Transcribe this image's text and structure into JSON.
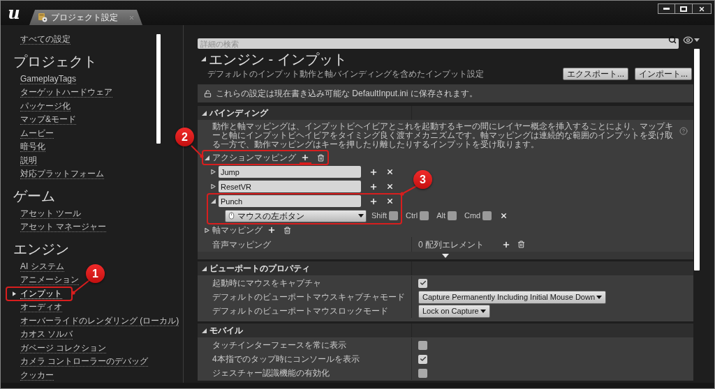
{
  "window": {
    "logo": "u",
    "tab": {
      "title": "プロジェクト設定",
      "selected": true
    }
  },
  "sidebar": {
    "items": [
      {
        "label": "すべての設定",
        "selected": false
      }
    ],
    "sections": [
      {
        "heading": "プロジェクト",
        "items": [
          {
            "label": "GameplayTags",
            "selected": false
          },
          {
            "label": "ターゲットハードウェア",
            "selected": false
          },
          {
            "label": "パッケージ化",
            "selected": false
          },
          {
            "label": "マップ&モード",
            "selected": false
          },
          {
            "label": "ムービー",
            "selected": false
          },
          {
            "label": "暗号化",
            "selected": false
          },
          {
            "label": "説明",
            "selected": false
          },
          {
            "label": "対応プラットフォーム",
            "selected": false
          }
        ]
      },
      {
        "heading": "ゲーム",
        "items": [
          {
            "label": "アセット ツール",
            "selected": false
          },
          {
            "label": "アセット マネージャー",
            "selected": false
          }
        ]
      },
      {
        "heading": "エンジン",
        "items": [
          {
            "label": "AI システム",
            "selected": false
          },
          {
            "label": "アニメーション",
            "selected": false
          },
          {
            "label": "インプット",
            "selected": true
          },
          {
            "label": "オーディオ",
            "selected": false
          },
          {
            "label": "オーバーライドのレンダリング (ローカル)",
            "selected": false
          },
          {
            "label": "カオス ソルバ",
            "selected": false
          },
          {
            "label": "ガベージ コレクション",
            "selected": false
          },
          {
            "label": "カメラ コントローラーのデバッグ",
            "selected": false
          },
          {
            "label": "クッカー",
            "selected": false
          }
        ]
      }
    ]
  },
  "search": {
    "placeholder": "詳細の検索"
  },
  "page": {
    "title": "エンジン - インプット",
    "expanded": true,
    "subtitle": "デフォルトのインプット動作と軸バインディングを含めたインプット設定",
    "buttons": [
      "エクスポート...",
      "インポート..."
    ]
  },
  "notice": "これらの設定は現在書き込み可能な DefaultInput.ini に保存されます。",
  "bindings": {
    "title": "バインディング",
    "expanded": true,
    "description": "動作と軸マッピングは、インプットビヘイビアとこれを起動するキーの間にレイヤー概念を挿入することにより、マップキーと軸にインプットビヘイビアをタイミング良く渡すメカニズムです。軸マッピングは連続的な範囲のインプットを受け取る一方で、動作マッピングはキーを押したり離したりするインプットを受け取ります。",
    "action_mappings": {
      "label": "アクションマッピング",
      "expanded": true,
      "items": [
        {
          "name": "Jump",
          "expanded": false
        },
        {
          "name": "ResetVR",
          "expanded": false
        },
        {
          "name": "Punch",
          "expanded": true,
          "keys": [
            {
              "key": "マウスの左ボタン",
              "modifiers": [
                {
                  "label": "Shift",
                  "checked": false
                },
                {
                  "label": "Ctrl",
                  "checked": false
                },
                {
                  "label": "Alt",
                  "checked": false
                },
                {
                  "label": "Cmd",
                  "checked": false
                }
              ]
            }
          ]
        }
      ]
    },
    "axis_mappings": {
      "label": "軸マッピング",
      "expanded": false
    },
    "speech_mappings": {
      "label": "音声マッピング",
      "value": "0 配列エレメント"
    }
  },
  "sections": [
    {
      "title": "ビューポートのプロパティ",
      "expanded": true,
      "rows": [
        {
          "kind": "checkbox",
          "label": "起動時にマウスをキャプチャ",
          "checked": true
        },
        {
          "kind": "dropdown",
          "label": "デフォルトのビューポートマウスキャプチャモード",
          "value": "Capture Permanently Including Initial Mouse Down"
        },
        {
          "kind": "dropdown",
          "label": "デフォルトのビューポートマウスロックモード",
          "value": "Lock on Capture"
        }
      ]
    },
    {
      "title": "モバイル",
      "expanded": true,
      "rows": [
        {
          "kind": "checkbox",
          "label": "タッチインターフェースを常に表示",
          "checked": false
        },
        {
          "kind": "checkbox",
          "label": "4本指でのタップ時にコンソールを表示",
          "checked": true
        },
        {
          "kind": "checkbox",
          "label": "ジェスチャー認識機能の有効化",
          "checked": false
        }
      ]
    }
  ],
  "annotations": [
    {
      "number": "1"
    },
    {
      "number": "2"
    },
    {
      "number": "3"
    }
  ]
}
